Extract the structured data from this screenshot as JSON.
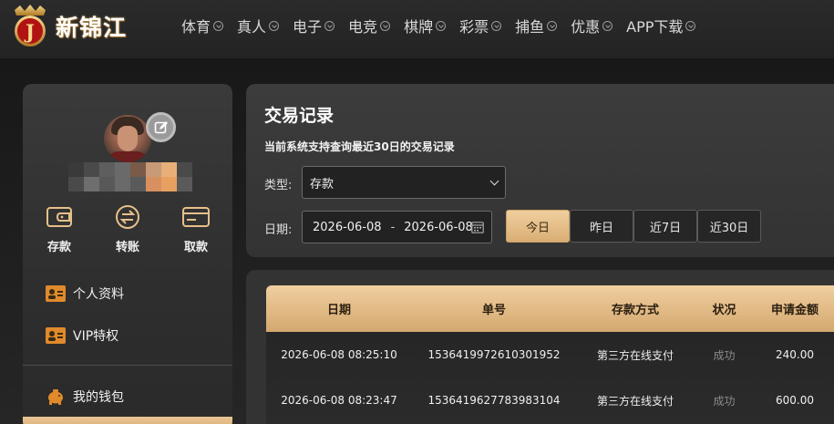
{
  "brand": {
    "name": "新锦江",
    "badge_letter": "J"
  },
  "nav": {
    "items": [
      {
        "label": "体育"
      },
      {
        "label": "真人"
      },
      {
        "label": "电子"
      },
      {
        "label": "电竞"
      },
      {
        "label": "棋牌"
      },
      {
        "label": "彩票"
      },
      {
        "label": "捕鱼"
      },
      {
        "label": "优惠"
      },
      {
        "label": "APP下载"
      }
    ]
  },
  "sidebar": {
    "wallet_actions": [
      {
        "label": "存款",
        "icon": "wallet-icon"
      },
      {
        "label": "转账",
        "icon": "transfer-icon"
      },
      {
        "label": "取款",
        "icon": "card-icon"
      }
    ],
    "menu": [
      {
        "label": "个人资料",
        "icon": "profile-card-icon"
      },
      {
        "label": "VIP特权",
        "icon": "vip-card-icon"
      },
      {
        "label": "我的钱包",
        "icon": "piggy-bank-icon"
      }
    ]
  },
  "filter": {
    "title": "交易记录",
    "notice": "当前系统支持查询最近30日的交易记录",
    "type_label": "类型:",
    "type_value": "存款",
    "date_label": "日期:",
    "date_start": "2026-06-08",
    "date_sep": "-",
    "date_end": "2026-06-08",
    "quick_buttons": [
      {
        "label": "今日",
        "active": true
      },
      {
        "label": "昨日",
        "active": false
      },
      {
        "label": "近7日",
        "active": false
      },
      {
        "label": "近30日",
        "active": false
      }
    ]
  },
  "table": {
    "columns": [
      "日期",
      "单号",
      "存款方式",
      "状况",
      "申请金额"
    ],
    "rows": [
      [
        "2026-06-08 08:25:10",
        "1536419972610301952",
        "第三方在线支付",
        "成功",
        "240.00"
      ],
      [
        "2026-06-08 08:23:47",
        "1536419627783983104",
        "第三方在线支付",
        "成功",
        "600.00"
      ]
    ]
  },
  "colors": {
    "accent_gold": "#e6c08a",
    "panel_bg": "#363636",
    "icon_orange": "#e08a2c"
  }
}
